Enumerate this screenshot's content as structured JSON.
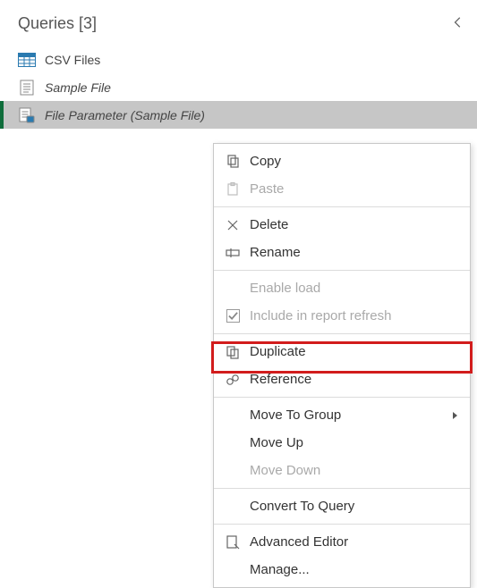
{
  "panel": {
    "title": "Queries [3]"
  },
  "queries": [
    {
      "label": "CSV Files"
    },
    {
      "label": "Sample File"
    },
    {
      "label": "File Parameter (Sample File)"
    }
  ],
  "menu": {
    "copy": "Copy",
    "paste": "Paste",
    "delete": "Delete",
    "rename": "Rename",
    "enable_load": "Enable load",
    "include_refresh": "Include in report refresh",
    "duplicate": "Duplicate",
    "reference": "Reference",
    "move_to_group": "Move To Group",
    "move_up": "Move Up",
    "move_down": "Move Down",
    "convert_to_query": "Convert To Query",
    "advanced_editor": "Advanced Editor",
    "manage": "Manage..."
  }
}
